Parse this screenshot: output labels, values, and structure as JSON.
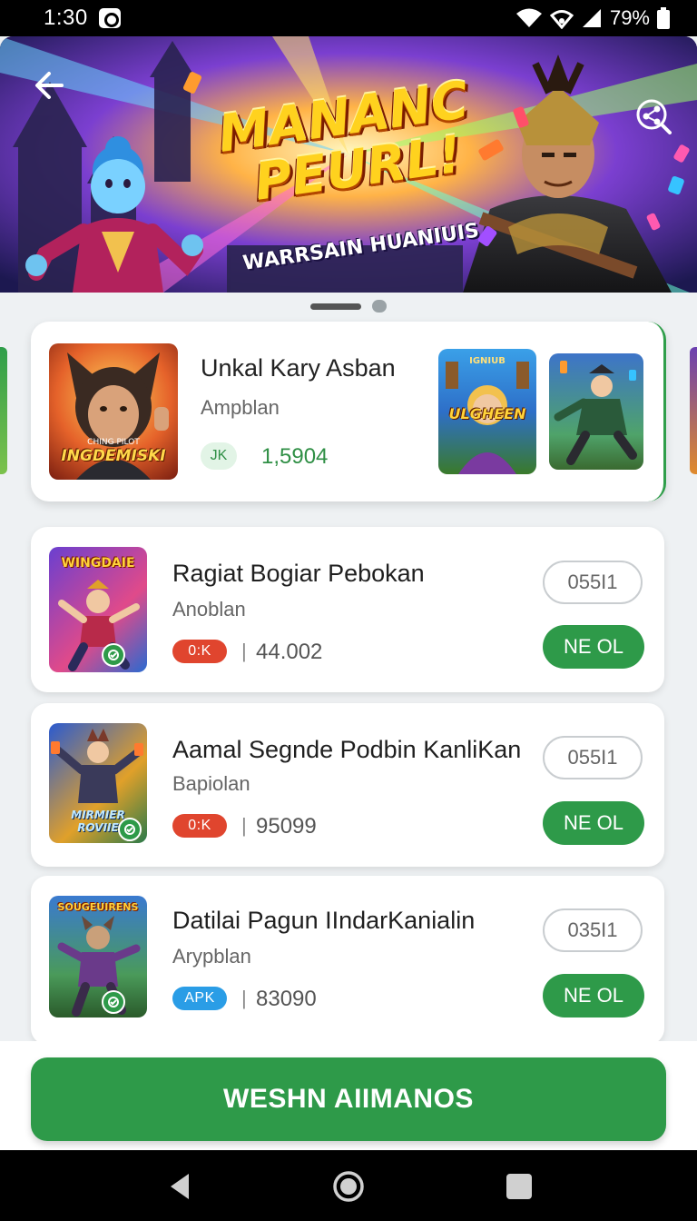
{
  "status_bar": {
    "time": "1:30",
    "battery": "79%",
    "icons": [
      "notification-icon",
      "wifi-icon",
      "hotspot-icon",
      "signal-icon",
      "battery-icon"
    ]
  },
  "hero": {
    "title_line1": "MANANC",
    "title_line2": "PEURL!",
    "subtitle": "WARRSAIN HUANIUIS",
    "back_icon": "back-arrow-icon",
    "share_icon": "share-icon"
  },
  "pager": {
    "pages": 2,
    "active": 0
  },
  "featured": {
    "name": "Unkal Kary Asban",
    "subtitle": "Ampblan",
    "badge": "JK",
    "count": "1,5904",
    "thumb_text": "INGDEMISKI",
    "thumb_small_text": "CHING PILOT",
    "shot1_text": "ULGHEEN",
    "shot1_small_text": "IGNIUB"
  },
  "apps": [
    {
      "name": "Ragiat Bogiar Pebokan",
      "subtitle": "Anoblan",
      "tag": "0:K",
      "tag_color": "#e0452e",
      "count": "44.002",
      "version": "055I1",
      "button": "NE OL",
      "thumb_text": "WINGDAIE"
    },
    {
      "name": "Aamal Segnde Podbin KanliKan",
      "subtitle": "Bapiolan",
      "tag": "0:K",
      "tag_color": "#e0452e",
      "count": "95099",
      "version": "055I1",
      "button": "NE OL",
      "thumb_text": "MIRMIER ROVIIE"
    },
    {
      "name": "Datilai Pagun IIndarKanialin",
      "subtitle": "Arypblan",
      "tag": "APK",
      "tag_color": "#2a9de6",
      "count": "83090",
      "version": "035I1",
      "button": "NE OL",
      "thumb_text": "SOUGEUIRENS"
    }
  ],
  "cta": {
    "label": "WESHN AIIMANOS"
  },
  "colors": {
    "accent": "#2e9a49",
    "red_tag": "#e0452e",
    "blue_tag": "#2a9de6"
  }
}
